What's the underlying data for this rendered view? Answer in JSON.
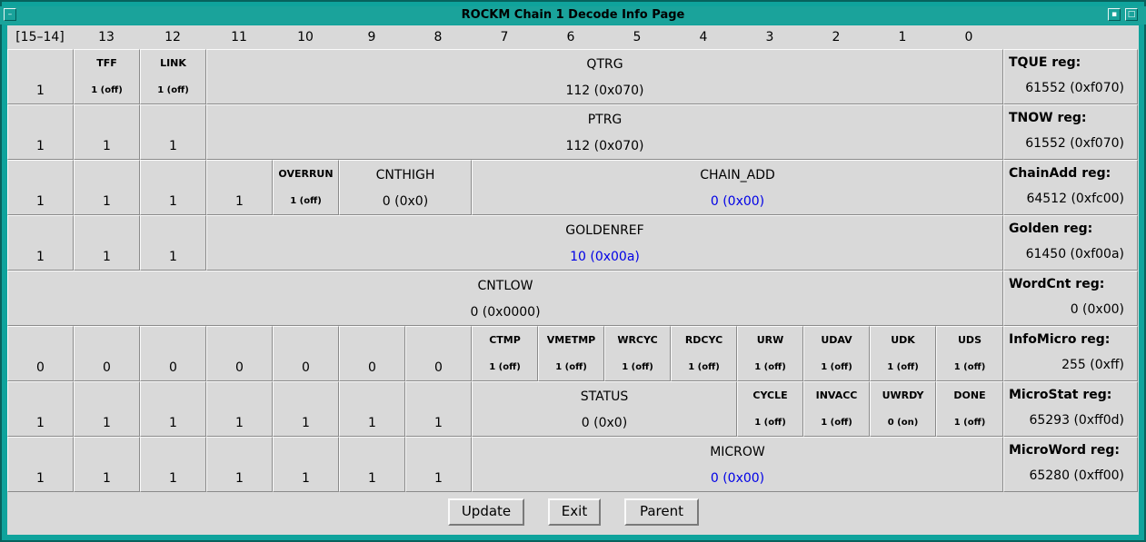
{
  "window": {
    "title": "ROCKM Chain 1 Decode Info Page",
    "menu_glyph": "–",
    "min_glyph": "▪",
    "max_glyph": "□"
  },
  "bit_header": [
    "[15–14]",
    "13",
    "12",
    "11",
    "10",
    "9",
    "8",
    "7",
    "6",
    "5",
    "4",
    "3",
    "2",
    "1",
    "0"
  ],
  "rows": [
    {
      "cells": [
        {
          "single": "1"
        },
        {
          "small_name": "TFF",
          "small_value": "1 (off)"
        },
        {
          "small_name": "LINK",
          "small_value": "1 (off)"
        },
        {
          "name": "QTRG",
          "value": "112 (0x070)"
        }
      ],
      "reg": {
        "name": "TQUE reg:",
        "value": "61552 (0xf070)"
      }
    },
    {
      "cells": [
        {
          "single": "1"
        },
        {
          "single": "1"
        },
        {
          "single": "1"
        },
        {
          "name": "PTRG",
          "value": "112 (0x070)"
        }
      ],
      "reg": {
        "name": "TNOW reg:",
        "value": "61552 (0xf070)"
      }
    },
    {
      "cells": [
        {
          "single": "1"
        },
        {
          "single": "1"
        },
        {
          "single": "1"
        },
        {
          "single": "1"
        },
        {
          "small_name": "OVERRUN",
          "small_value": "1 (off)"
        },
        {
          "name": "CNTHIGH",
          "value": "0 (0x0)"
        },
        {
          "name": "CHAIN_ADD",
          "value": "0 (0x00)"
        }
      ],
      "reg": {
        "name": "ChainAdd reg:",
        "value": "64512 (0xfc00)"
      }
    },
    {
      "cells": [
        {
          "single": "1"
        },
        {
          "single": "1"
        },
        {
          "single": "1"
        },
        {
          "name": "GOLDENREF",
          "value": "10 (0x00a)"
        }
      ],
      "reg": {
        "name": "Golden reg:",
        "value": "61450 (0xf00a)"
      }
    },
    {
      "cells": [
        {
          "name": "CNTLOW",
          "value": "0 (0x0000)"
        }
      ],
      "reg": {
        "name": "WordCnt reg:",
        "value": "0 (0x00)"
      }
    },
    {
      "cells": [
        {
          "single": "0"
        },
        {
          "single": "0"
        },
        {
          "single": "0"
        },
        {
          "single": "0"
        },
        {
          "single": "0"
        },
        {
          "single": "0"
        },
        {
          "single": "0"
        },
        {
          "small_name": "CTMP",
          "small_value": "1 (off)"
        },
        {
          "small_name": "VMETMP",
          "small_value": "1 (off)"
        },
        {
          "small_name": "WRCYC",
          "small_value": "1 (off)"
        },
        {
          "small_name": "RDCYC",
          "small_value": "1 (off)"
        },
        {
          "small_name": "URW",
          "small_value": "1 (off)"
        },
        {
          "small_name": "UDAV",
          "small_value": "1 (off)"
        },
        {
          "small_name": "UDK",
          "small_value": "1 (off)"
        },
        {
          "small_name": "UDS",
          "small_value": "1 (off)"
        }
      ],
      "reg": {
        "name": "InfoMicro reg:",
        "value": "255 (0xff)"
      }
    },
    {
      "cells": [
        {
          "single": "1"
        },
        {
          "single": "1"
        },
        {
          "single": "1"
        },
        {
          "single": "1"
        },
        {
          "single": "1"
        },
        {
          "single": "1"
        },
        {
          "single": "1"
        },
        {
          "name": "STATUS",
          "value": "0 (0x0)"
        },
        {
          "small_name": "CYCLE",
          "small_value": "1 (off)"
        },
        {
          "small_name": "INVACC",
          "small_value": "1 (off)"
        },
        {
          "small_name": "UWRDY",
          "small_value": "0 (on)"
        },
        {
          "small_name": "DONE",
          "small_value": "1 (off)"
        }
      ],
      "reg": {
        "name": "MicroStat reg:",
        "value": "65293 (0xff0d)"
      }
    },
    {
      "cells": [
        {
          "single": "1"
        },
        {
          "single": "1"
        },
        {
          "single": "1"
        },
        {
          "single": "1"
        },
        {
          "single": "1"
        },
        {
          "single": "1"
        },
        {
          "single": "1"
        },
        {
          "name": "MICROW",
          "value": "0 (0x00)"
        }
      ],
      "reg": {
        "name": "MicroWord reg:",
        "value": "65280 (0xff00)"
      }
    }
  ],
  "highlight_color": "#0000e6",
  "highlighted_fields": [
    "CHAIN_ADD",
    "GOLDENREF",
    "MICROW"
  ],
  "buttons": {
    "update": "Update",
    "exit": "Exit",
    "parent": "Parent"
  }
}
